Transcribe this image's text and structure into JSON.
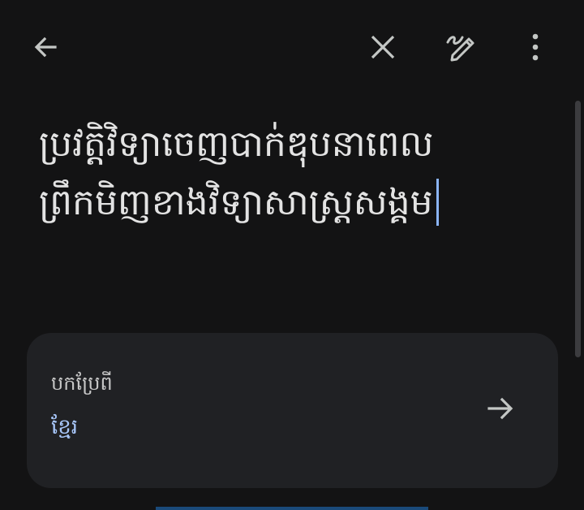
{
  "toolbar": {
    "back_icon": "arrow-left-icon",
    "clear_icon": "close-icon",
    "handwriting_icon": "pen-scribble-icon",
    "more_icon": "more-vertical-icon"
  },
  "input": {
    "text": "ប្រវត្តិវិទ្យាចេញបាក់ឌុបនាពេលព្រឹកមិញខាងវិទ្យាសាស្រ្តសង្គម"
  },
  "translate_card": {
    "title": "បកប្រែពី",
    "language": "ខ្មែរ",
    "arrow_icon": "arrow-right-icon"
  },
  "colors": {
    "background": "#131314",
    "card": "#202124",
    "text": "#e3e3e3",
    "accent": "#a8c7fa"
  }
}
